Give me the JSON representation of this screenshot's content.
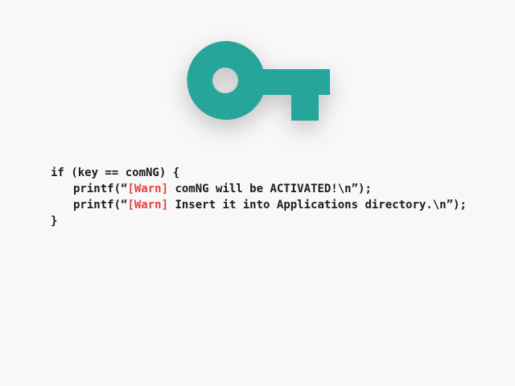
{
  "icon": {
    "name": "key-icon",
    "color": "#26a69a"
  },
  "code": {
    "line1": "if (key == comNG) {",
    "line2": {
      "prefix": "printf(“",
      "tag": "[Warn]",
      "message": " comNG will be ACTIVATED!\\n”);"
    },
    "line3": {
      "prefix": "printf(“",
      "tag": "[Warn]",
      "message": " Insert it into Applications directory.\\n”);"
    },
    "line4": "}"
  },
  "colors": {
    "background": "#f8f8f8",
    "text": "#1b1b1b",
    "warn": "#e0443c",
    "accent": "#26a69a"
  }
}
